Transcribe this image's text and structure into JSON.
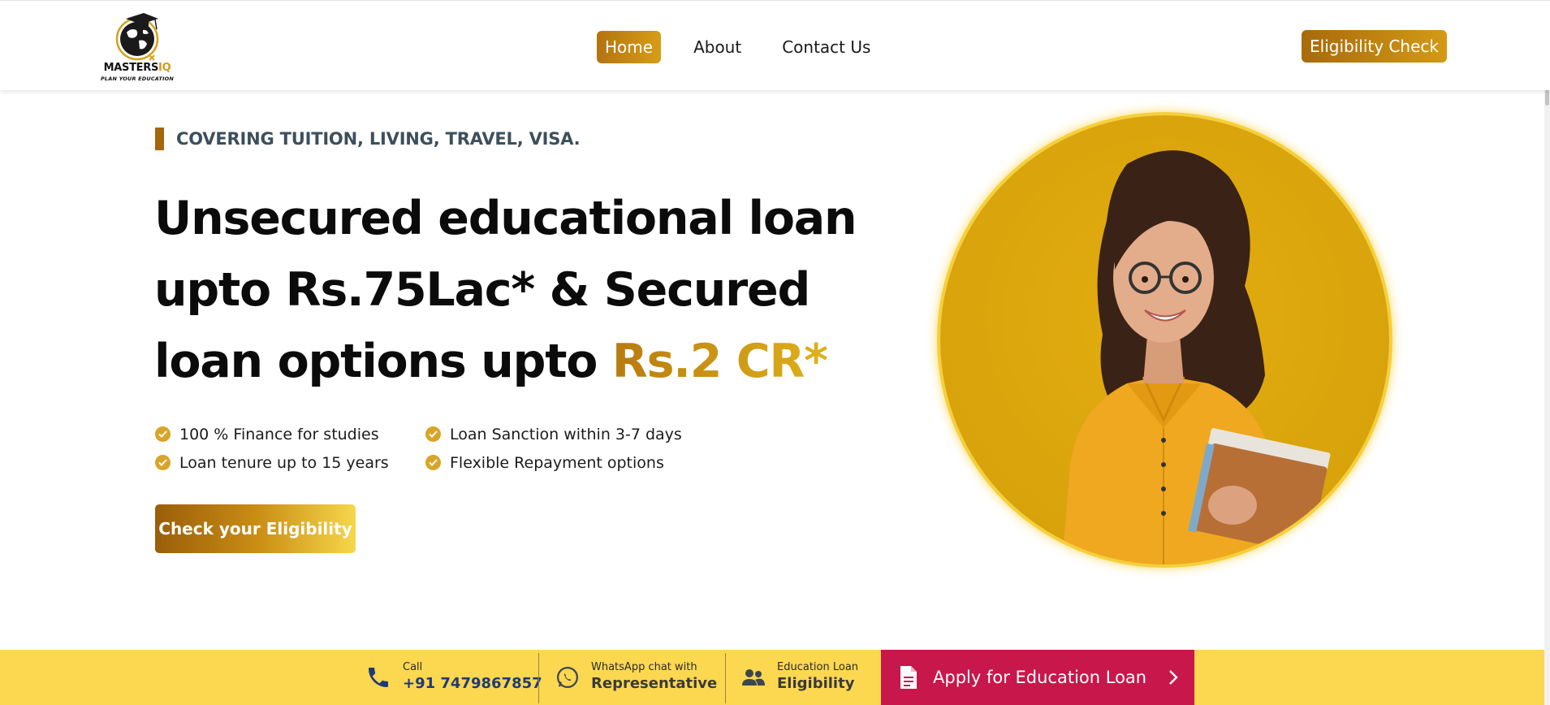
{
  "brand": {
    "name_main": "MASTERS",
    "name_accent": "IQ",
    "tagline": "PLAN YOUR EDUCATION"
  },
  "nav": {
    "items": [
      {
        "label": "Home",
        "active": true
      },
      {
        "label": "About",
        "active": false
      },
      {
        "label": "Contact Us",
        "active": false
      }
    ]
  },
  "header": {
    "eligibility_label": "Eligibility Check"
  },
  "hero": {
    "kicker": "COVERING TUITION, LIVING, TRAVEL, VISA.",
    "headline_line1": "Unsecured educational loan",
    "headline_line2": "upto Rs.75Lac* & Secured",
    "headline_line3": "loan options upto ",
    "headline_highlight": "Rs.2 CR*",
    "features": [
      "100 % Finance for studies",
      "Loan Sanction within 3-7 days",
      "Loan tenure up to 15 years",
      "Flexible Repayment options"
    ],
    "cta_label": "Check your Eligibility"
  },
  "bottom_bar": {
    "call": {
      "small": "Call",
      "big": "+91 7479867857"
    },
    "whatsapp": {
      "small": "WhatsApp chat with",
      "big": "Representative"
    },
    "eligibility": {
      "small": "Education Loan",
      "big": "Eligibility"
    },
    "apply_label": "Apply for Education Loan"
  },
  "colors": {
    "accent": "#c98c14",
    "highlight_yellow": "#fcd750",
    "apply_red": "#c8174a",
    "kicker_text": "#3d4f5c"
  },
  "icons": [
    "globe-logo-icon",
    "check-circle-icon",
    "phone-icon",
    "whatsapp-icon",
    "people-icon",
    "document-icon",
    "chevron-right-icon"
  ]
}
